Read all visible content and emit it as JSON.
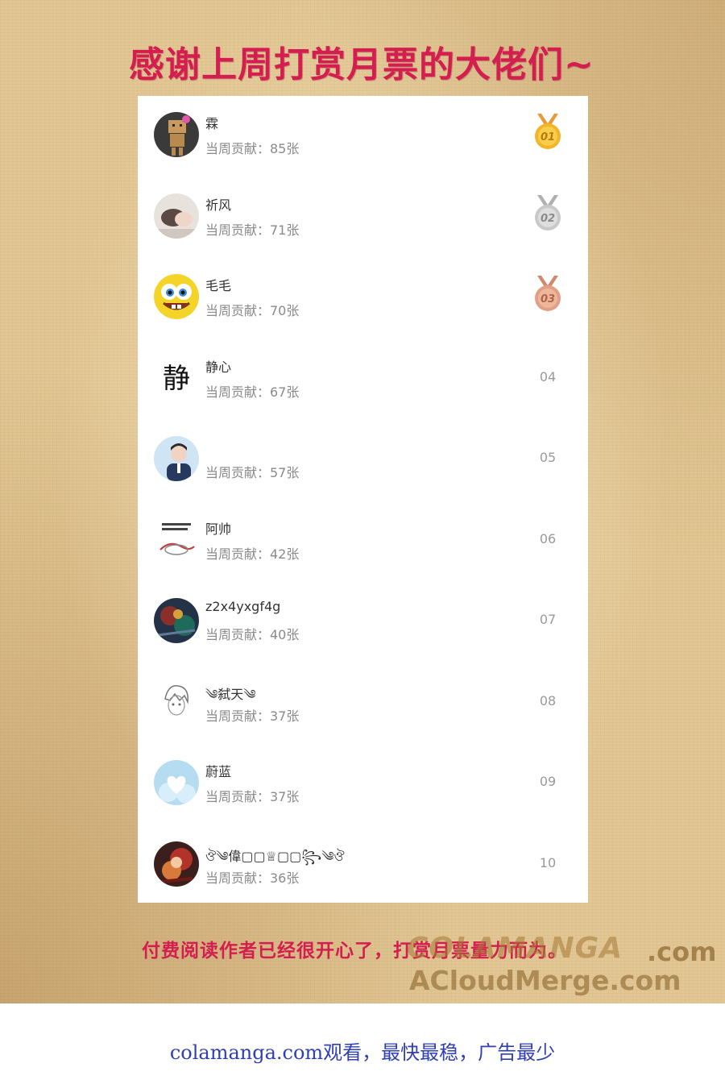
{
  "title": "感谢上周打赏月票的大佬们~",
  "ranking": [
    {
      "name": "霖",
      "contribution": "当周贡献：85张",
      "rank": "01",
      "medal": "gold",
      "avatar": "cardboard-robot-avatar"
    },
    {
      "name": "祈风",
      "contribution": "当周贡献：71张",
      "rank": "02",
      "medal": "silver",
      "avatar": "person-photo-avatar"
    },
    {
      "name": "毛毛",
      "contribution": "当周贡献：70张",
      "rank": "03",
      "medal": "bronze",
      "avatar": "sponge-cartoon-avatar"
    },
    {
      "name": "静心",
      "contribution": "当周贡献：67张",
      "rank": "04",
      "medal": "",
      "avatar": "calligraphy-avatar"
    },
    {
      "name": "",
      "contribution": "当周贡献：57张",
      "rank": "05",
      "medal": "",
      "avatar": "boy-photo-avatar"
    },
    {
      "name": "阿帅",
      "contribution": "当周贡献：42张",
      "rank": "06",
      "medal": "",
      "avatar": "doodle-avatar"
    },
    {
      "name": "z2x4yxgf4g",
      "contribution": "当周贡献：40张",
      "rank": "07",
      "medal": "",
      "avatar": "dark-art-avatar"
    },
    {
      "name": "༄弑天༄",
      "contribution": "当周贡献：37张",
      "rank": "08",
      "medal": "",
      "avatar": "anime-sketch-avatar"
    },
    {
      "name": "蔚蓝",
      "contribution": "当周贡献：37张",
      "rank": "09",
      "medal": "",
      "avatar": "heart-cloud-avatar"
    },
    {
      "name": "ঔ༄偉▢▢♕▢▢꧂༄ঔ",
      "contribution": "当周贡献：36张",
      "rank": "10",
      "medal": "",
      "avatar": "red-art-avatar"
    }
  ],
  "footer": "付费阅读作者已经很开心了，打赏月票量力而为。",
  "watermark": {
    "line1": "COLAMANGA",
    "line1_suffix": ".com",
    "line2": "ACloudMerge.com"
  },
  "promo": "colamanga.com观看，最快最稳，广告最少",
  "colors": {
    "accent": "#d41e50",
    "promo": "#2f3fb5",
    "gold": "#f2b527",
    "silver": "#c9c9c9",
    "bronze": "#e0a085",
    "paper": "#e2c794"
  }
}
